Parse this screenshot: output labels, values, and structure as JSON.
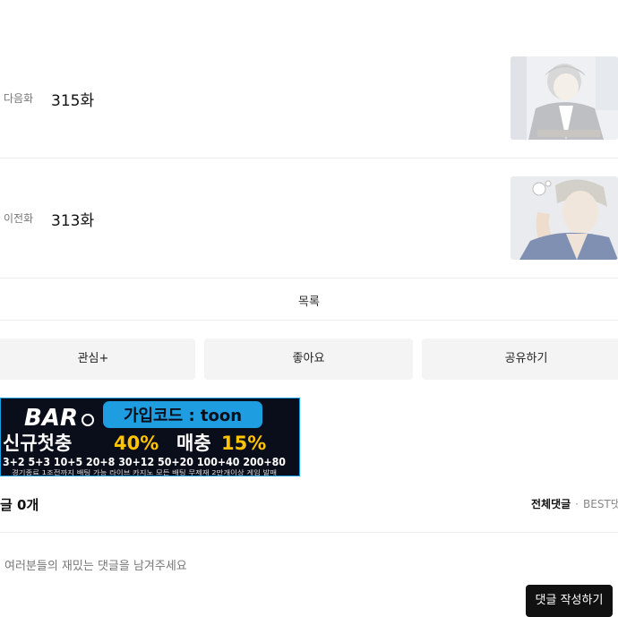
{
  "next_episode": {
    "tag": "다음화",
    "title": "315화"
  },
  "prev_episode": {
    "tag": "이전화",
    "title": "313화"
  },
  "list_label": "목록",
  "actions": {
    "favorite": "관심+",
    "like": "좋아요",
    "share": "공유하기"
  },
  "banner": {
    "logo": "BAR",
    "code_label": "가입코드 : toon",
    "headline_left": "신규첫충",
    "headline_pct1": "40%",
    "headline_mid": "매충",
    "headline_pct2": "15%",
    "bonus_row": "3+2 5+3 10+5 20+8 30+12 50+20 100+40 200+80",
    "fine_print": "경기종료 1조전까지 배팅 가능 라이브 카지노 모든 배팅 무제재 2만개이상 게임 발매"
  },
  "comments": {
    "count_label": "글 0개",
    "sort_all": "전체댓글",
    "sort_best": "BEST댓",
    "placeholder": "여러분들의 재밌는 댓글을 남겨주세요",
    "write_button": "댓글 작성하기"
  },
  "colors": {
    "accent_cyan": "#29b6f6",
    "accent_yellow": "#ffc400",
    "button_dark": "#111111"
  }
}
